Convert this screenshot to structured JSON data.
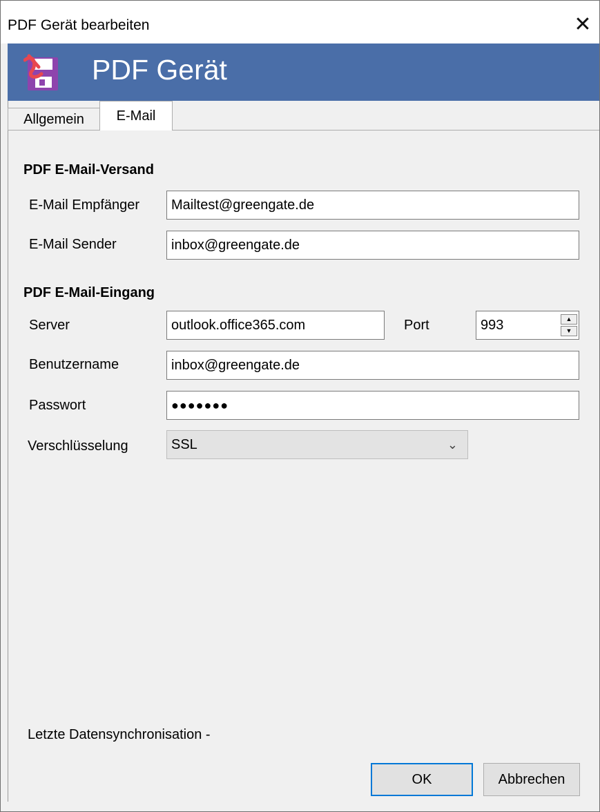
{
  "window": {
    "title": "PDF Gerät bearbeiten",
    "close_glyph": "✕"
  },
  "banner": {
    "title": "PDF Gerät",
    "icon": "pdf-save-icon",
    "color": "#4a6ea8"
  },
  "tabs": [
    {
      "label": "Allgemein",
      "active": false
    },
    {
      "label": "E-Mail",
      "active": true
    }
  ],
  "versand": {
    "heading": "PDF E-Mail-Versand",
    "empfaenger_label": "E-Mail Empfänger",
    "empfaenger_value": "Mailtest@greengate.de",
    "sender_label": "E-Mail Sender",
    "sender_value": "inbox@greengate.de"
  },
  "eingang": {
    "heading": "PDF E-Mail-Eingang",
    "server_label": "Server",
    "server_value": "outlook.office365.com",
    "port_label": "Port",
    "port_value": "993",
    "user_label": "Benutzername",
    "user_value": "inbox@greengate.de",
    "password_label": "Passwort",
    "password_value": "●●●●●●●",
    "encryption_label": "Verschlüsselung",
    "encryption_value": "SSL"
  },
  "footer": {
    "sync_label": "Letzte Datensynchronisation  -",
    "ok_label": "OK",
    "cancel_label": "Abbrechen"
  }
}
